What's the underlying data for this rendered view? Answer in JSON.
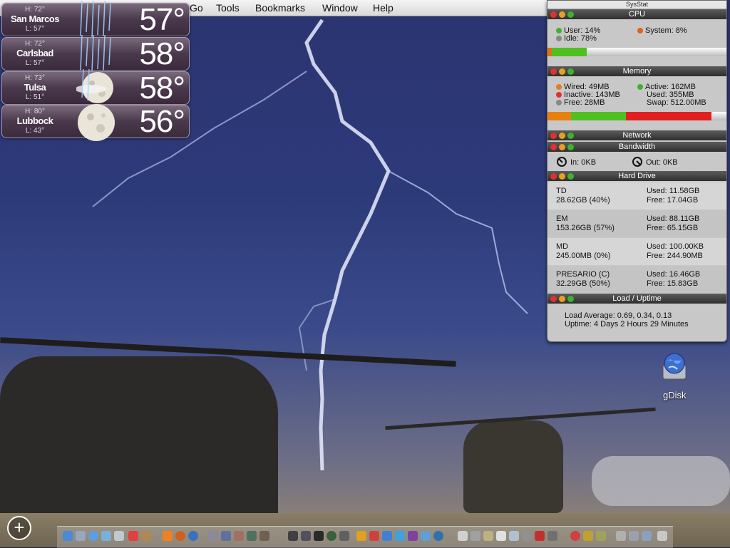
{
  "menubar": {
    "items": [
      "Go",
      "Tools",
      "Bookmarks",
      "Window",
      "Help"
    ]
  },
  "weather": [
    {
      "city": "San Marcos",
      "high": "H: 72°",
      "low": "L: 57°",
      "temp": "57°",
      "icon": "rain-icon"
    },
    {
      "city": "Carlsbad",
      "high": "H: 72°",
      "low": "L: 57°",
      "temp": "58°",
      "icon": "rain-icon"
    },
    {
      "city": "Tulsa",
      "high": "H: 73°",
      "low": "L: 51°",
      "temp": "58°",
      "icon": "moon-cloudy-rain-icon"
    },
    {
      "city": "Lubbock",
      "high": "H: 80°",
      "low": "L: 43°",
      "temp": "56°",
      "icon": "moon-icon"
    }
  ],
  "sysstat": {
    "title": "SysStat",
    "cpu": {
      "header": "CPU",
      "user": "User: 14%",
      "system": "System: 8%",
      "idle": "Idle: 78%",
      "user_fraction": 0.14,
      "system_fraction": 0.08
    },
    "memory": {
      "header": "Memory",
      "wired": "Wired: 49MB",
      "active": "Active: 162MB",
      "inactive": "Inactive: 143MB",
      "used": "Used: 355MB",
      "free": "Free: 28MB",
      "swap": "Swap: 512.00MB"
    },
    "network": {
      "header": "Network"
    },
    "bandwidth": {
      "header": "Bandwidth",
      "in": "In: 0KB",
      "out": "Out: 0KB"
    },
    "harddrive": {
      "header": "Hard Drive",
      "drives": [
        {
          "name": "TD",
          "size": "28.62GB (40%)",
          "used": "Used: 11.58GB",
          "free": "Free: 17.04GB"
        },
        {
          "name": "EM",
          "size": "153.26GB (57%)",
          "used": "Used: 88.11GB",
          "free": "Free: 65.15GB"
        },
        {
          "name": "MD",
          "size": "245.00MB (0%)",
          "used": "Used: 100.00KB",
          "free": "Free: 244.90MB"
        },
        {
          "name": "PRESARIO (C)",
          "size": "32.29GB (50%)",
          "used": "Used: 16.46GB",
          "free": "Free: 15.83GB"
        }
      ]
    },
    "load": {
      "header": "Load / Uptime",
      "load_average": "Load Average: 0.69, 0.34, 0.13",
      "uptime": "Uptime: 4 Days 2 Hours 29 Minutes"
    }
  },
  "desktop_icons": [
    {
      "label": "gDisk",
      "icon": "gdisk-globe-icon"
    }
  ],
  "colors": {
    "red_light": "#e03030",
    "yellow_light": "#e8a020",
    "green_light": "#40b030",
    "header_bg": "#3a3a3a"
  }
}
